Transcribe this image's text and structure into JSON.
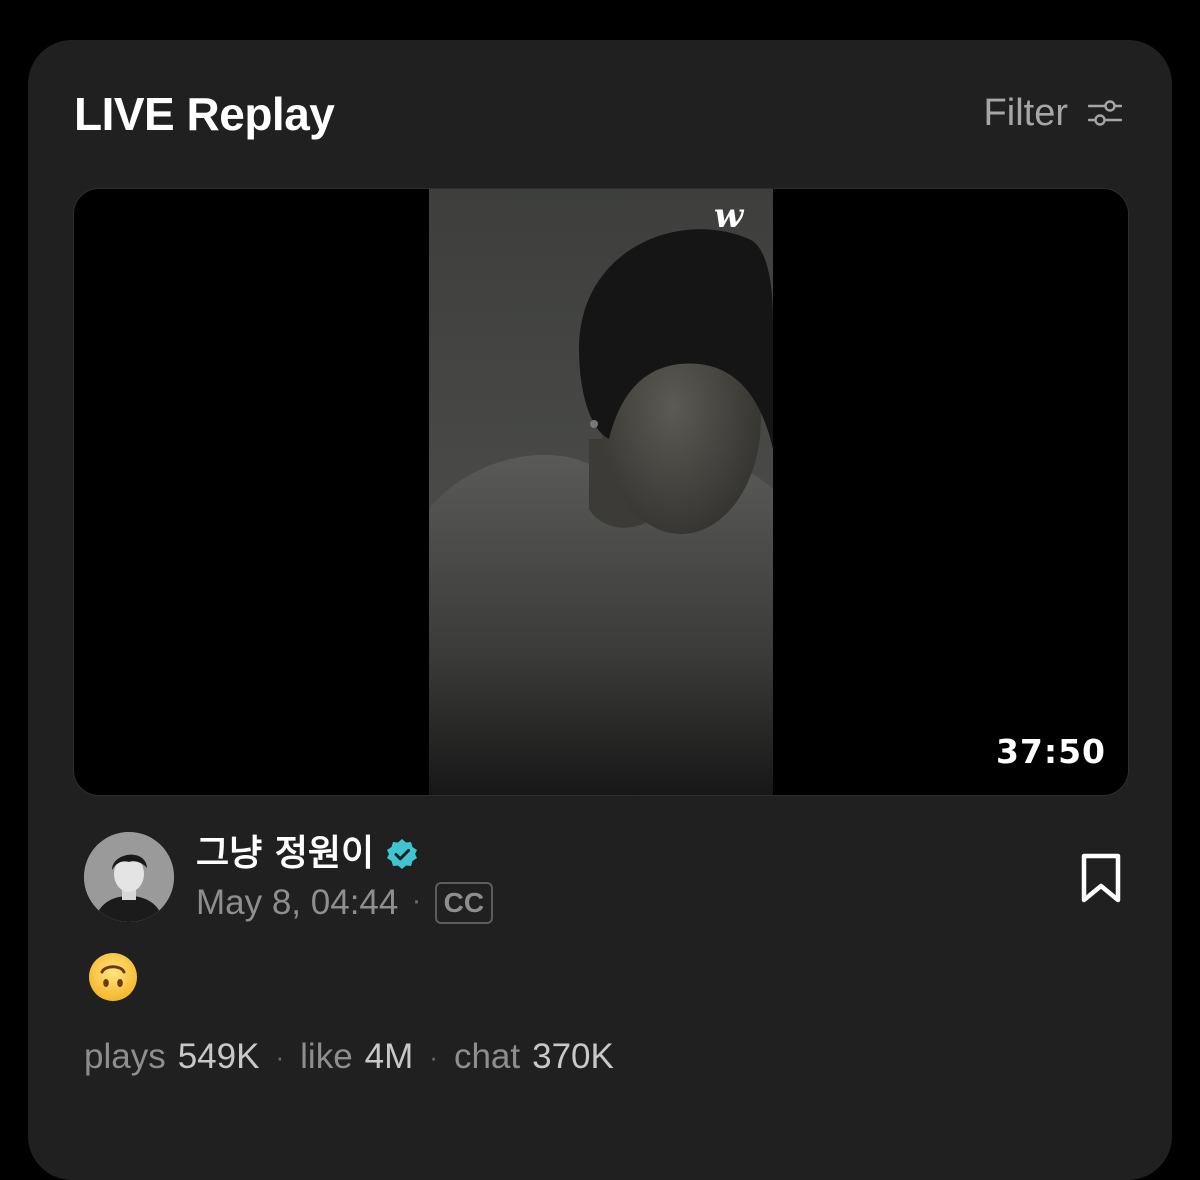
{
  "header": {
    "title": "LIVE Replay",
    "filter_label": "Filter",
    "filter_icon": "sliders-icon"
  },
  "video": {
    "logo_text": "w",
    "duration": "37:50"
  },
  "post": {
    "author_name": "그냥 정원이",
    "verified_icon": "verified-badge-icon",
    "date": "May 8, 04:44",
    "separator": "·",
    "cc_label": "CC",
    "bookmark_icon": "bookmark-icon",
    "message_emoji": "upside-down-face-emoji"
  },
  "stats": {
    "plays_label": "plays",
    "plays_value": "549K",
    "like_label": "like",
    "like_value": "4M",
    "chat_label": "chat",
    "chat_value": "370K",
    "separator": "·"
  },
  "colors": {
    "background": "#000000",
    "card": "#202020",
    "verified": "#3fc5d0",
    "muted_text": "#8e8e8e"
  }
}
